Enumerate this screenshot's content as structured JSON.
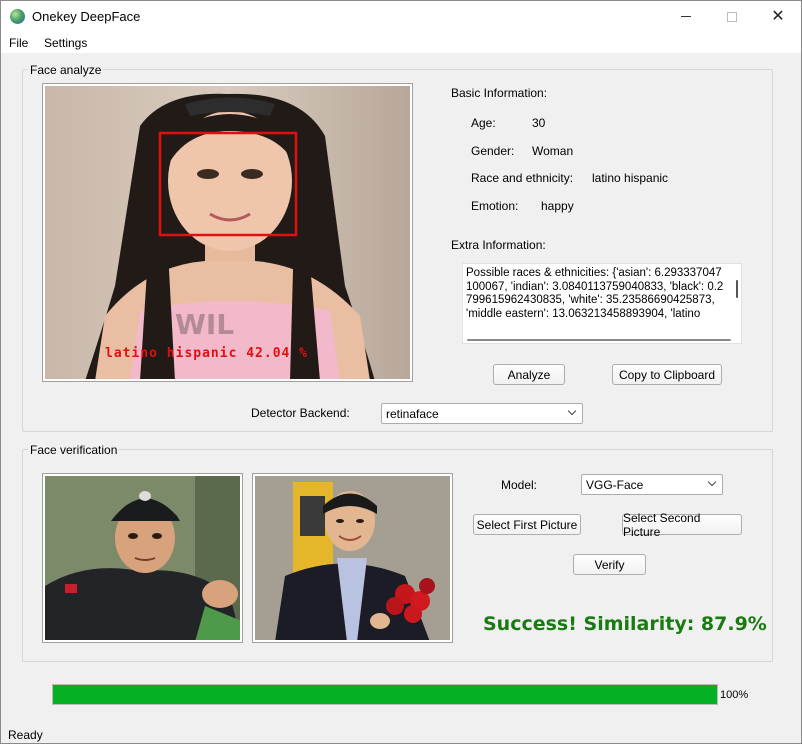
{
  "window": {
    "title": "Onekey DeepFace"
  },
  "menu": [
    "File",
    "Settings"
  ],
  "analyze": {
    "group_title": "Face analyze",
    "image_caption": "latino hispanic  42.04 %",
    "basic_info_title": "Basic Information:",
    "age_label": "Age:",
    "age_value": "30",
    "gender_label": "Gender:",
    "gender_value": "Woman",
    "race_label": "Race and ethnicity:",
    "race_value": "latino hispanic",
    "emotion_label": "Emotion:",
    "emotion_value": "happy",
    "extra_info_title": "Extra Information:",
    "extra_info_text": "Possible races & ethnicities: {'asian': 6.293337047100067, 'indian': 3.0840113759040833, 'black': 0.2799615962430835, 'white': 35.23586690425873, 'middle eastern': 13.063213458893904, 'latino",
    "analyze_button": "Analyze",
    "copy_button": "Copy to Clipboard",
    "detector_label": "Detector Backend:",
    "detector_value": "retinaface"
  },
  "verify": {
    "group_title": "Face verification",
    "model_label": "Model:",
    "model_value": "VGG-Face",
    "select_first_button": "Select First Picture",
    "select_second_button": "Select Second Picture",
    "verify_button": "Verify",
    "result_text": "Success! Similarity: 87.9%"
  },
  "progress": {
    "value": 1.0,
    "label": "100%"
  },
  "status": {
    "text": "Ready"
  },
  "colors": {
    "success_text": "#1a7a12",
    "progress_fill": "#06b025",
    "face_box": "#e01010",
    "caption_red": "#e01010"
  }
}
